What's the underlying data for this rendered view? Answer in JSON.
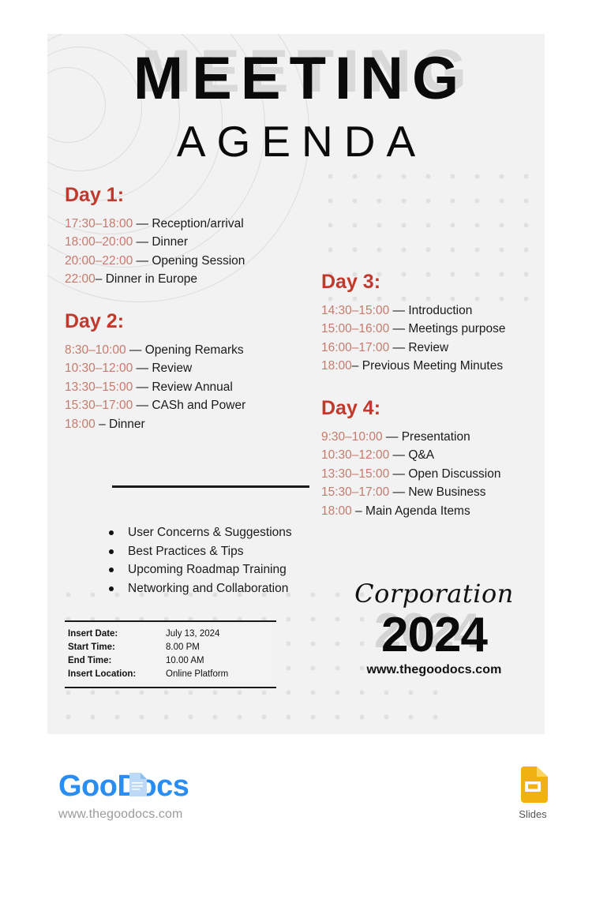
{
  "title": {
    "line1": "MEETING",
    "line2": "AGENDA"
  },
  "colors": {
    "accent_red": "#c0392b",
    "time_rose": "#c47b6d",
    "card_bg": "#f2f2f2",
    "ink": "#1a1a1a",
    "brand_blue": "#2a8df2",
    "slides_yellow": "#f5b40a"
  },
  "days": [
    {
      "heading": "Day 1:",
      "items": [
        {
          "time": "17:30–18:00",
          "sep": " — ",
          "desc": "Reception/arrival"
        },
        {
          "time": "18:00–20:00",
          "sep": " — ",
          "desc": "Dinner"
        },
        {
          "time": "20:00–22:00",
          "sep": " — ",
          "desc": "Opening Session"
        },
        {
          "time": "22:00",
          "sep": "– ",
          "desc": "Dinner in Europe"
        }
      ]
    },
    {
      "heading": "Day 2:",
      "items": [
        {
          "time": "8:30–10:00",
          "sep": " — ",
          "desc": "Opening Remarks"
        },
        {
          "time": "10:30–12:00",
          "sep": " — ",
          "desc": "Review"
        },
        {
          "time": "13:30–15:00",
          "sep": " — ",
          "desc": "Review Annual"
        },
        {
          "time": "15:30–17:00",
          "sep": " — ",
          "desc": "CASh and Power"
        },
        {
          "time": "18:00",
          "sep": " – ",
          "desc": "Dinner"
        }
      ]
    },
    {
      "heading": "Day 3:",
      "items": [
        {
          "time": "14:30–15:00",
          "sep": " — ",
          "desc": "Introduction"
        },
        {
          "time": "15:00–16:00",
          "sep": " — ",
          "desc": "Meetings purpose"
        },
        {
          "time": "16:00–17:00",
          "sep": " — ",
          "desc": "Review"
        },
        {
          "time": "18:00",
          "sep": "– ",
          "desc": "Previous Meeting Minutes"
        }
      ]
    },
    {
      "heading": "Day 4:",
      "items": [
        {
          "time": "9:30–10:00",
          "sep": " — ",
          "desc": "Presentation"
        },
        {
          "time": "10:30–12:00",
          "sep": " — ",
          "desc": "Q&A"
        },
        {
          "time": "13:30–15:00",
          "sep": " — ",
          "desc": "Open Discussion"
        },
        {
          "time": "15:30–17:00",
          "sep": " — ",
          "desc": "New Business"
        },
        {
          "time": "18:00",
          "sep": " – ",
          "desc": "Main Agenda Items"
        }
      ]
    }
  ],
  "bullets": [
    "User Concerns & Suggestions",
    "Best Practices & Tips",
    "Upcoming Roadmap Training",
    "Networking and Collaboration"
  ],
  "info": {
    "rows": [
      {
        "label": "Insert Date:",
        "value": "July 13, 2024"
      },
      {
        "label": "Start Time:",
        "value": " 8.00 PM"
      },
      {
        "label": "End Time:",
        "value": "10.00 AM"
      },
      {
        "label": "Insert Location:",
        "value": "Online Platform"
      }
    ]
  },
  "corporation": {
    "script": "Corporation",
    "year": "2024",
    "url": "www.thegoodocs.com"
  },
  "footer": {
    "logo_text": "GooDocs",
    "url": "www.thegoodocs.com",
    "slides_label": "Slides"
  }
}
